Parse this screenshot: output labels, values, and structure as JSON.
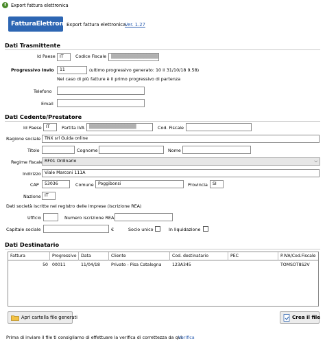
{
  "window": {
    "title": "Export fattura elettronica"
  },
  "header": {
    "logo_text": "FatturaElettronica",
    "title": "Export fattura elettronica",
    "version": "Ver. 1.27"
  },
  "trasmittente": {
    "section": "Dati Trasmittente",
    "id_paese_label": "Id Paese",
    "id_paese": "IT",
    "codice_fiscale_label": "Codice Fiscale",
    "codice_fiscale": "████████████████",
    "progressivo_label": "Progressivo Invio",
    "progressivo": "11",
    "progressivo_note": "(ultimo progressivo generato: 10 il 31/10/18 9.58)",
    "multi_note": "Nel caso di più fatture è il primo progressivo di partenza",
    "telefono_label": "Telefono",
    "telefono": "",
    "email_label": "Email",
    "email": ""
  },
  "cedente": {
    "section": "Dati Cedente/Prestatore",
    "id_paese_label": "Id Paese",
    "id_paese": "IT",
    "partita_iva_label": "Partita IVA",
    "partita_iva": "████████████████",
    "cod_fiscale_label": "Cod. Fiscale",
    "cod_fiscale": "",
    "ragione_sociale_label": "Ragione sociale",
    "ragione_sociale": "TNX srl Guida online",
    "titolo_label": "Titolo",
    "titolo": "",
    "cognome_label": "Cognome",
    "cognome": "",
    "nome_label": "Nome",
    "nome": "",
    "regime_label": "Regime fiscale",
    "regime": "RF01 Ordinario",
    "indirizzo_label": "Indirizzo",
    "indirizzo": "Viale Marconi 111A",
    "cap_label": "CAP",
    "cap": "53036",
    "comune_label": "Comune",
    "comune": "Poggibonsi",
    "provincia_label": "Provincia",
    "provincia": "SI",
    "nazione_label": "Nazione",
    "nazione": "IT",
    "rea_note": "Dati società iscritte nel registro delle imprese (iscrizione REA)",
    "ufficio_label": "Ufficio",
    "ufficio": "",
    "numero_rea_label": "Numero iscrizione REA",
    "numero_rea": "",
    "capitale_label": "Capitale sociale",
    "capitale": "",
    "currency": "€",
    "socio_unico_label": "Socio unico",
    "liquidazione_label": "In liquidazione"
  },
  "destinatario": {
    "section": "Dati Destinatario",
    "columns": [
      "Fattura",
      "Progressivo",
      "Data",
      "Cliente",
      "Cod. destinatario",
      "PEC",
      "P.IVA/Cod.Fiscale"
    ],
    "rows": [
      [
        "50",
        "00011",
        "11/04/18",
        "Privato - Pisa Catalogna",
        "123A345",
        "",
        "TOMSOT8S2V"
      ]
    ]
  },
  "buttons": {
    "open_folder": "Apri cartella file generati",
    "create_file": "Crea il file"
  },
  "footer": {
    "note": "Prima di inviare il file ti consigliamo di effettuare la verifica di correttezza da qui:",
    "link": "Verifica"
  },
  "colors": {
    "logo_bg": "#2d66b3",
    "link": "#2a5db0"
  }
}
